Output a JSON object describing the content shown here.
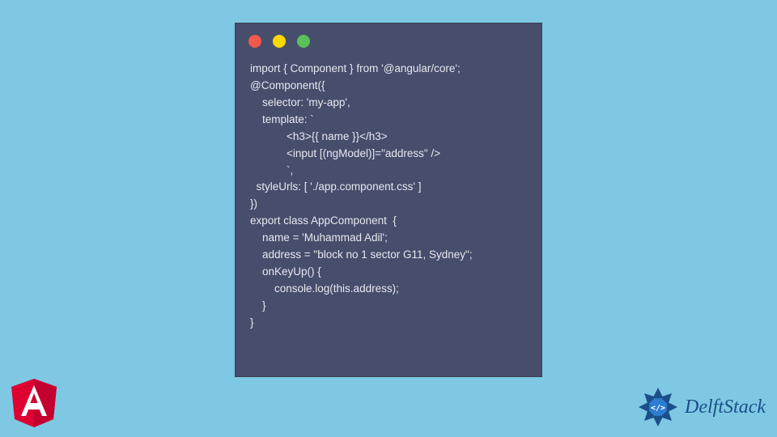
{
  "code": {
    "lines": [
      "import { Component } from '@angular/core';",
      "@Component({",
      "    selector: 'my-app',",
      "    template: `",
      "            <h3>{{ name }}</h3>",
      "            <input [(ngModel)]=\"address\" />",
      "            `,",
      "  styleUrls: [ './app.component.css' ]",
      "})",
      "export class AppComponent  {",
      "    name = 'Muhammad Adil';",
      "    address = \"block no 1 sector G11, Sydney\";",
      "    onKeyUp() {",
      "        console.log(this.address);",
      "    }",
      "}"
    ]
  },
  "branding": {
    "delftstack_label": "DelftStack"
  },
  "colors": {
    "background": "#7ec8e3",
    "window_bg": "#474e6c",
    "code_text": "#e6e8ef",
    "dot_red": "#ed594a",
    "dot_yellow": "#fdd800",
    "dot_green": "#5ac05a",
    "angular_red": "#dd0031",
    "angular_dark": "#c3002f",
    "delft_blue": "#1b4f8a"
  }
}
